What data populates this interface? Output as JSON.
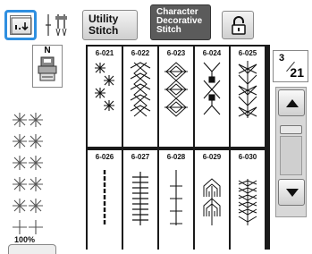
{
  "toolbar": {
    "needle_mode_icon": "needle-position-icon",
    "twin_needle_icon": "twin-needle-icon",
    "utility_label_line1": "Utility",
    "utility_label_line2": "Stitch",
    "character_label_line1": "Character",
    "character_label_line2": "Decorative",
    "character_label_line3": "Stitch",
    "lock_icon": "lock-icon",
    "highlight_color": "#2f8fe0"
  },
  "presser_foot": {
    "letter": "N"
  },
  "preview": {
    "zoom": "100%"
  },
  "stitches": [
    {
      "code": "6-021"
    },
    {
      "code": "6-022"
    },
    {
      "code": "6-023"
    },
    {
      "code": "6-024"
    },
    {
      "code": "6-025"
    },
    {
      "code": "6-026"
    },
    {
      "code": "6-027"
    },
    {
      "code": "6-028"
    },
    {
      "code": "6-029"
    },
    {
      "code": "6-030"
    }
  ],
  "pagination": {
    "current": "3",
    "total": "21"
  }
}
